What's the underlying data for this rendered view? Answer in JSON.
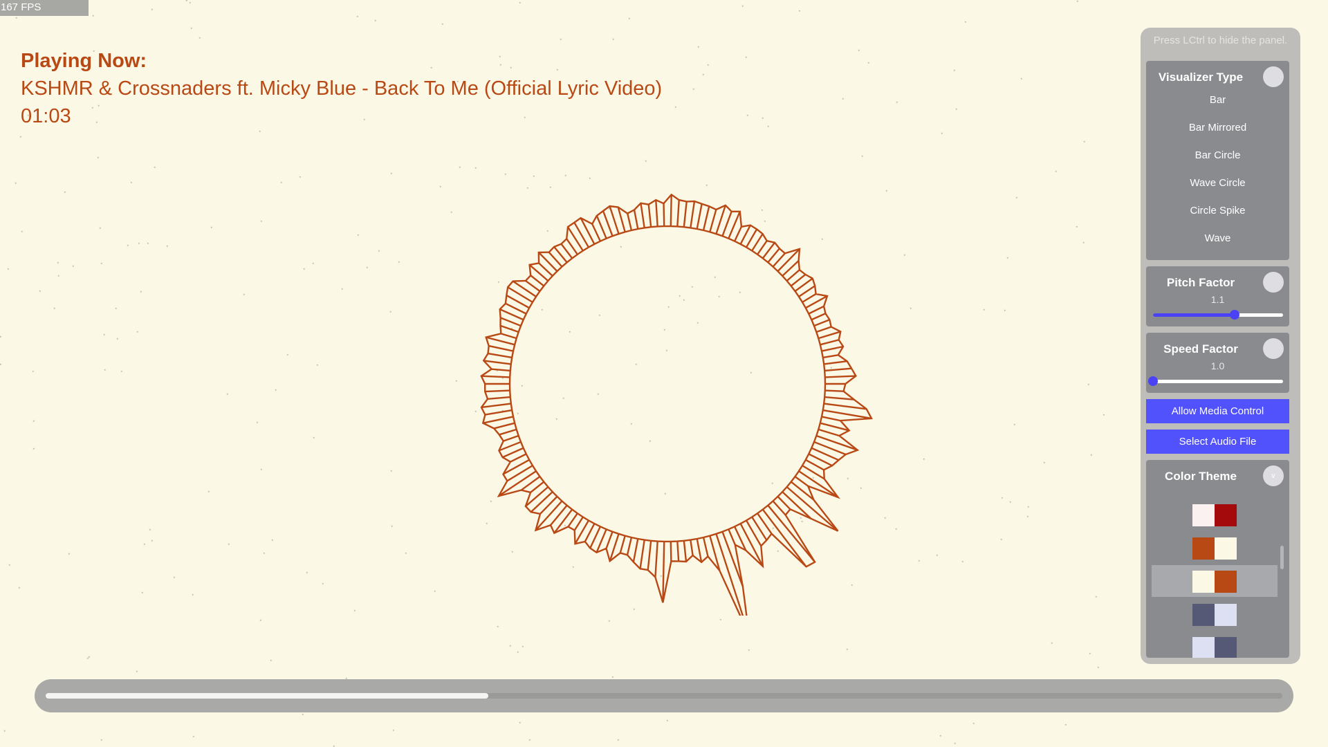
{
  "fps": {
    "label": "167 FPS"
  },
  "now_playing": {
    "heading": "Playing Now:",
    "title": "KSHMR & Crossnaders ft. Micky Blue - Back To Me (Official Lyric Video)",
    "time": "01:03"
  },
  "playback": {
    "progress": 0.358
  },
  "panel": {
    "hint": "Press LCtrl to hide the panel.",
    "visualizer_type": {
      "title": "Visualizer Type",
      "items": [
        "Bar",
        "Bar Mirrored",
        "Bar Circle",
        "Wave Circle",
        "Circle Spike",
        "Wave"
      ]
    },
    "pitch": {
      "title": "Pitch Factor",
      "value_text": "1.1",
      "fraction": 0.63
    },
    "speed": {
      "title": "Speed Factor",
      "value_text": "1.0",
      "fraction": 0.0
    },
    "allow_media_label": "Allow Media Control",
    "select_audio_label": "Select Audio File",
    "color_theme": {
      "title": "Color Theme",
      "toggle_glyph": "v",
      "themes": [
        {
          "a": "#fcf1f1",
          "b": "#a40a0b",
          "selected": false
        },
        {
          "a": "#b84915",
          "b": "#fcf8e6",
          "selected": false
        },
        {
          "a": "#fcf8e6",
          "b": "#b84915",
          "selected": true
        },
        {
          "a": "#555975",
          "b": "#dde0f3",
          "selected": false
        },
        {
          "a": "#dde0f3",
          "b": "#555975",
          "selected": false
        }
      ]
    }
  },
  "colors": {
    "background": "#fcf8e6",
    "accent": "#b84915",
    "button": "#5252fd"
  }
}
